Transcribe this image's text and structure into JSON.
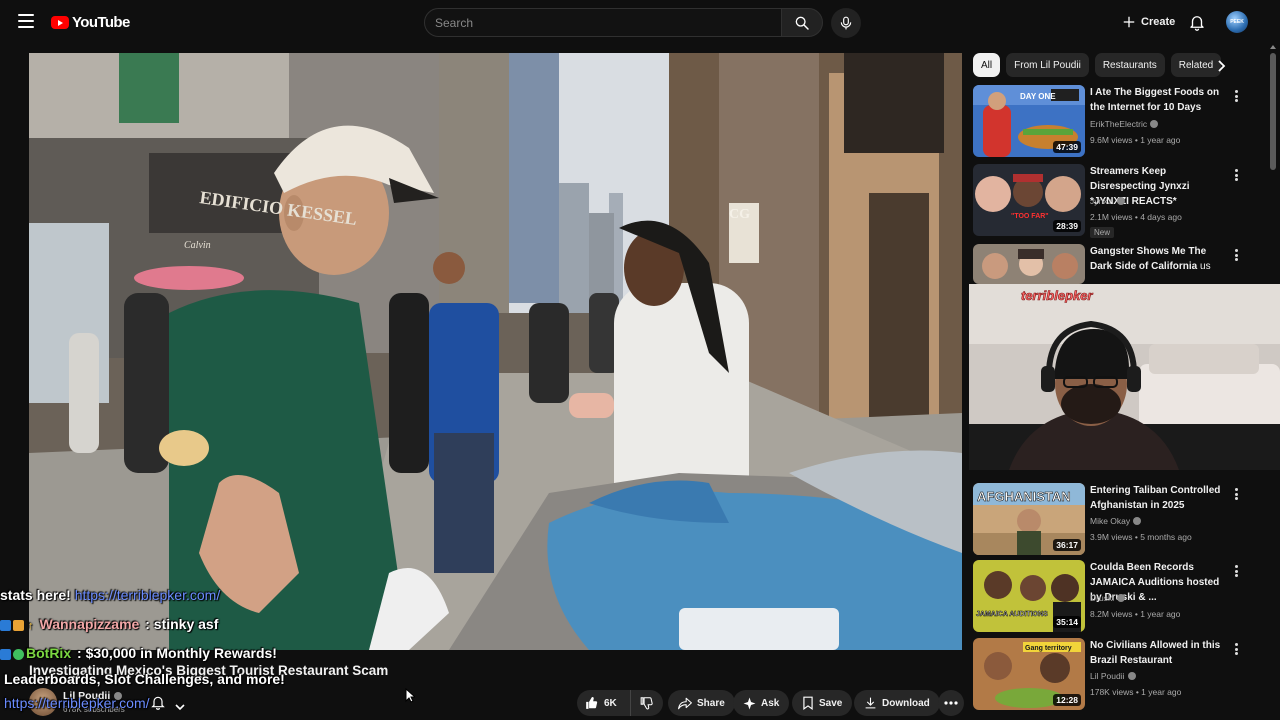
{
  "header": {
    "logo_text": "YouTube",
    "search_placeholder": "Search",
    "create_label": "Create",
    "avatar_text": "PEEK"
  },
  "video": {
    "title": "Investigating Mexico's Biggest Tourist Restaurant Scam",
    "channel": "Lil Poudii",
    "subscribers": "678K subscribers",
    "likes": "6K",
    "actions": {
      "share": "Share",
      "ask": "Ask",
      "save": "Save",
      "download": "Download"
    },
    "scene_text": {
      "storefront": "EDIFICIO KESSEL",
      "storefront_small": "Calvin",
      "cg_sign": "CG"
    }
  },
  "chips": [
    {
      "label": "All",
      "active": true
    },
    {
      "label": "From Lil Poudii",
      "active": false
    },
    {
      "label": "Restaurants",
      "active": false
    },
    {
      "label": "Related",
      "active": false
    }
  ],
  "recommendations": [
    {
      "title": "I Ate The Biggest Foods on the Internet for 10 Days",
      "channel": "ErikTheElectric",
      "meta": "9.6M views • 1 year ago",
      "duration": "47:39",
      "thumb_text": "DAY ONE"
    },
    {
      "title": "Streamers Keep Disrespecting Jynxzi *JYNXZI REACTS*",
      "channel": "Jynxzi",
      "meta": "2.1M views • 4 days ago",
      "duration": "28:39",
      "badge": "New",
      "thumb_text": "\"TOO FAR\""
    },
    {
      "title": "Gangster Shows Me The Dark Side of California",
      "channel": "",
      "meta": "",
      "duration": "",
      "title_suffix": "us"
    },
    {
      "title": "Entering Taliban Controlled Afghanistan in 2025",
      "channel": "Mike Okay",
      "meta": "3.9M views • 5 months ago",
      "duration": "36:17",
      "thumb_text": "AFGHANISTAN"
    },
    {
      "title": "Coulda Been Records JAMAICA Auditions hosted by Druski & ...",
      "channel": "Druski",
      "meta": "8.2M views • 1 year ago",
      "duration": "35:14",
      "thumb_text": "JAMAICA AUDITIONS"
    },
    {
      "title": "No Civilians Allowed in this Brazil Restaurant",
      "channel": "Lil Poudii",
      "meta": "178K views • 1 year ago",
      "duration": "12:28",
      "thumb_text": "Gang territory"
    }
  ],
  "webcam": {
    "overlay_text": "terriblepker"
  },
  "chat_overlay": {
    "line1_text": "stats here!",
    "line1_link": "https://terriblepker.com/",
    "line2_user": "Wannapizzame",
    "line2_msg": ": stinky asf",
    "line3_user": "BotRix",
    "line3_msg": ": $30,000 in Monthly Rewards!",
    "line4_text": "Leaderboards, Slot Challenges, and more!",
    "line5_link": "https://terriblepker.com/"
  },
  "colors": {
    "background": "#0f0f0f",
    "brand_red": "#ff0000",
    "chip_bg": "#272727",
    "link_blue": "#6b8cff",
    "botrix_green": "#7bd641"
  }
}
